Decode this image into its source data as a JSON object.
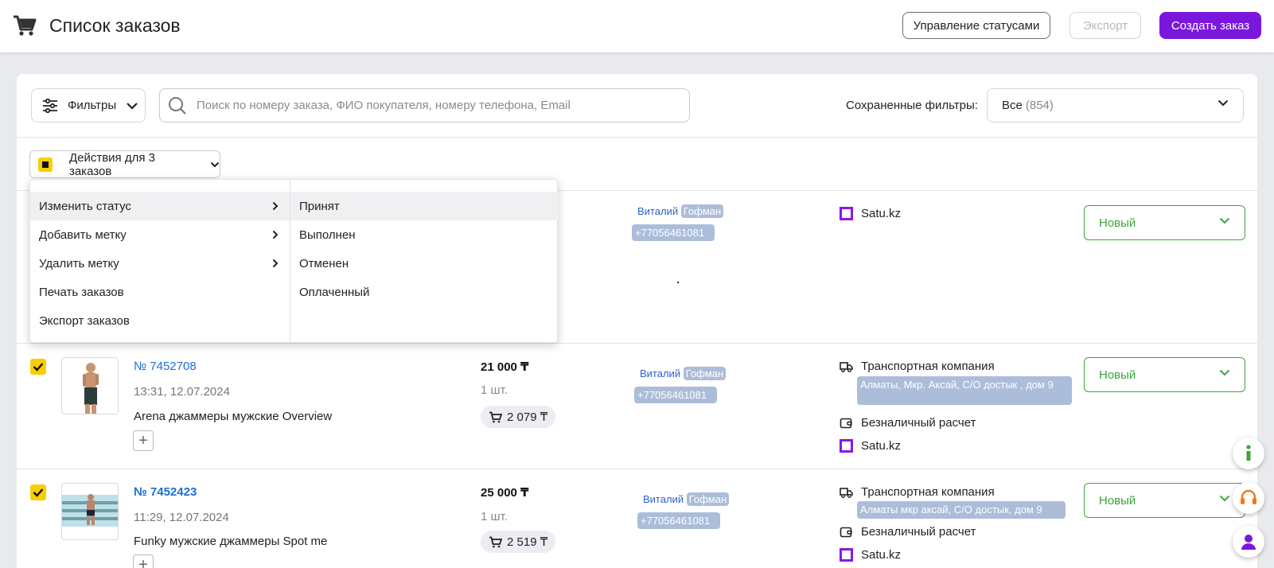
{
  "header": {
    "title": "Список заказов",
    "manage_statuses": "Управление статусами",
    "export": "Экспорт",
    "create_order": "Создать заказ"
  },
  "toolbar": {
    "filters": "Фильтры",
    "search_placeholder": "Поиск по номеру заказа, ФИО покупателя, номеру телефона, Email",
    "saved_filters_label": "Сохраненные фильтры:",
    "saved_filters_value": "Все",
    "saved_filters_count": "(854)"
  },
  "bulk": {
    "label": "Действия для 3 заказов"
  },
  "dropdown": {
    "menu": [
      {
        "label": "Изменить статус",
        "submenu": true
      },
      {
        "label": "Добавить метку",
        "submenu": true
      },
      {
        "label": "Удалить метку",
        "submenu": true
      },
      {
        "label": "Печать заказов",
        "submenu": false
      },
      {
        "label": "Экспорт заказов",
        "submenu": false
      }
    ],
    "statuses": [
      "Принят",
      "Выполнен",
      "Отменен",
      "Оплаченный"
    ]
  },
  "orders": [
    {
      "customer_name": "Виталий",
      "customer_surname": "Гофман",
      "phone": "+77056461081",
      "source": "Satu.kz",
      "status": "Новый"
    },
    {
      "number": "№ 7452708",
      "datetime": "13:31, 12.07.2024",
      "product": "Arena джаммеры мужские Overview",
      "price": "21 000 ₸",
      "qty": "1 шт.",
      "cart_amount": "2 079 ₸",
      "customer_name": "Виталий",
      "customer_surname": "Гофман",
      "phone": "+77056461081",
      "delivery": "Транспортная компания",
      "address": "Алматы, Мкр. Аксай, С/О достык , дом 9",
      "payment": "Безналичный расчет",
      "source": "Satu.kz",
      "status": "Новый"
    },
    {
      "number": "№ 7452423",
      "datetime": "11:29, 12.07.2024",
      "product": "Funky мужские джаммеры Spot me",
      "price": "25 000 ₸",
      "qty": "1 шт.",
      "cart_amount": "2 519 ₸",
      "customer_name": "Виталий",
      "customer_surname": "Гофман",
      "phone": "+77056461081",
      "delivery": "Транспортная компания",
      "address": "Алматы мкр аксай, С/О достык, дом 9",
      "payment": "Безналичный расчет",
      "source": "Satu.kz",
      "status": "Новый"
    }
  ],
  "colors": {
    "accent": "#7b17dd",
    "status_green": "#3ea33a",
    "checkbox_yellow": "#f7cf00",
    "link_blue": "#1a6ed8"
  },
  "icons": [
    "cart-icon",
    "filter-sliders-icon",
    "chevron-down-icon",
    "search-icon",
    "chevron-right-icon",
    "truck-icon",
    "wallet-icon",
    "info-icon",
    "headset-icon",
    "user-icon",
    "plus-icon"
  ]
}
